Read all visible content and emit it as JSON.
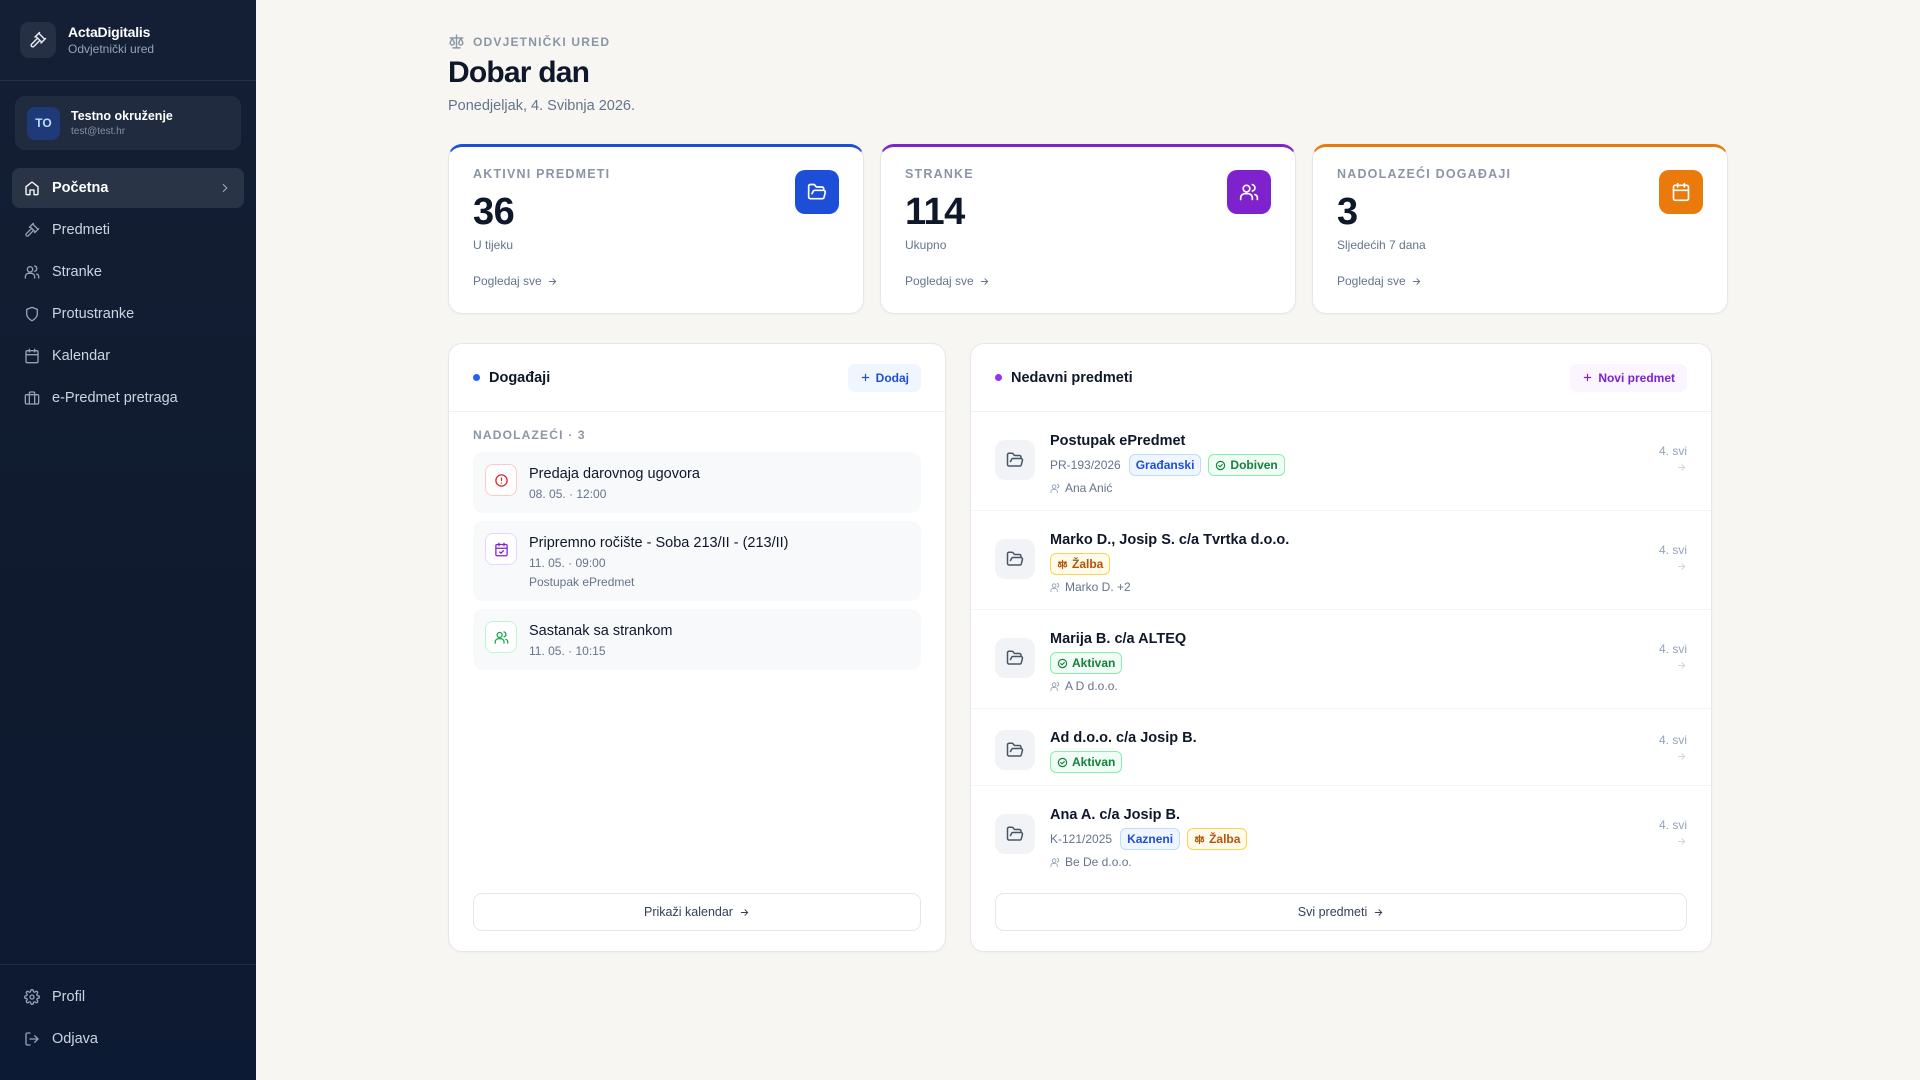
{
  "brand": {
    "name": "ActaDigitalis",
    "subtitle": "Odvjetnički ured"
  },
  "user": {
    "initials": "TO",
    "name": "Testno okruženje",
    "email": "test@test.hr"
  },
  "nav": {
    "items": [
      {
        "label": "Početna",
        "icon": "home-icon",
        "active": true
      },
      {
        "label": "Predmeti",
        "icon": "gavel-icon"
      },
      {
        "label": "Stranke",
        "icon": "users-icon"
      },
      {
        "label": "Protustranke",
        "icon": "shield-icon"
      },
      {
        "label": "Kalendar",
        "icon": "calendar-icon"
      },
      {
        "label": "e-Predmet pretraga",
        "icon": "building-icon"
      }
    ],
    "bottom": [
      {
        "label": "Profil",
        "icon": "gear-icon"
      },
      {
        "label": "Odjava",
        "icon": "logout-icon"
      }
    ]
  },
  "header": {
    "eyebrow": "ODVJETNIČKI URED",
    "title": "Dobar dan",
    "date": "Ponedjeljak, 4. Svibnja 2026."
  },
  "stats": [
    {
      "label": "AKTIVNI PREDMETI",
      "value": "36",
      "sub": "U tijeku",
      "link": "Pogledaj sve",
      "color": "#1d4ed8",
      "icon": "folder-icon"
    },
    {
      "label": "STRANKE",
      "value": "114",
      "sub": "Ukupno",
      "link": "Pogledaj sve",
      "color": "#7e22ce",
      "icon": "users-icon"
    },
    {
      "label": "NADOLAZEĆI DOGAĐAJI",
      "value": "3",
      "sub": "Sljedećih 7 dana",
      "link": "Pogledaj sve",
      "color": "#ea7a0c",
      "icon": "calendar-icon"
    }
  ],
  "events": {
    "title": "Događaji",
    "add_label": "Dodaj",
    "section": "NADOLAZEĆI · 3",
    "items": [
      {
        "title": "Predaja darovnog ugovora",
        "meta": "08. 05. · 12:00",
        "extra": "",
        "icon": "alert-circle-icon",
        "color": "#dc2626"
      },
      {
        "title": "Pripremno ročište - Soba 213/II - (213/II)",
        "meta": "11. 05. · 09:00",
        "extra": "Postupak ePredmet",
        "icon": "calendar-check-icon",
        "color": "#7e22ce"
      },
      {
        "title": "Sastanak sa strankom",
        "meta": "11. 05. · 10:15",
        "extra": "",
        "icon": "users-icon",
        "color": "#16a34a"
      }
    ],
    "footer": "Prikaži kalendar"
  },
  "cases": {
    "title": "Nedavni predmeti",
    "add_label": "Novi predmet",
    "items": [
      {
        "title": "Postupak ePredmet",
        "number": "PR-193/2026",
        "badges": [
          {
            "text": "Građanski",
            "kind": "blue"
          },
          {
            "text": "Dobiven",
            "kind": "green-check"
          }
        ],
        "party": "Ana Anić",
        "date": "4. svi"
      },
      {
        "title": "Marko D., Josip S. c/a Tvrtka d.o.o.",
        "number": "",
        "badges": [
          {
            "text": "Žalba",
            "kind": "amber-scale"
          }
        ],
        "party": "Marko D. +2",
        "date": "4. svi"
      },
      {
        "title": "Marija B. c/a ALTEQ",
        "number": "",
        "badges": [
          {
            "text": "Aktivan",
            "kind": "green-check"
          }
        ],
        "party": "A D d.o.o.",
        "date": "4. svi"
      },
      {
        "title": "Ad d.o.o. c/a Josip B.",
        "number": "",
        "badges": [
          {
            "text": "Aktivan",
            "kind": "green-check"
          }
        ],
        "party": "",
        "date": "4. svi"
      },
      {
        "title": "Ana A. c/a Josip B.",
        "number": "K-121/2025",
        "badges": [
          {
            "text": "Kazneni",
            "kind": "blue"
          },
          {
            "text": "Žalba",
            "kind": "amber-scale"
          }
        ],
        "party": "Be De d.o.o.",
        "date": "4. svi"
      }
    ],
    "footer": "Svi predmeti"
  }
}
